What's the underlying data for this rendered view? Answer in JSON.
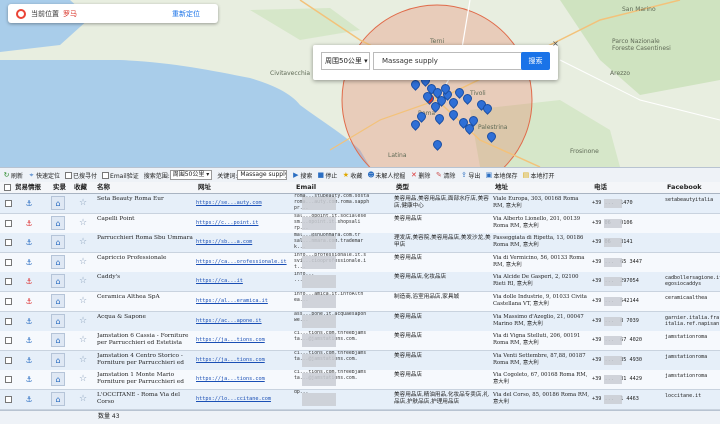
{
  "map": {
    "location_label": "当前位置",
    "city": "罗马",
    "relocate": "重新定位",
    "radius_select": "周围50公里",
    "keyword": "Massage supply",
    "search_button": "搜索",
    "close": "×",
    "labels": [
      "San Marino",
      "Parco Nazionale",
      "Foreste Casentinesi",
      "Arezzo",
      "Terni",
      "Tivoli",
      "Palestrina",
      "Latina",
      "Roma",
      "Civitavecchia",
      "Frosinone"
    ]
  },
  "toolbar": {
    "refresh": "刷新",
    "quick_locate": "快速定位",
    "visited_filter": "已搜寻付",
    "email_verify": "Email验证",
    "search_range_label": "搜索范围:",
    "search_range_value": "周围50公里",
    "keyword_label": "关键词:",
    "keyword_value": "Massage supply",
    "search": "搜索",
    "stop": "停止",
    "favorites": "收藏",
    "unhandled": "未解人挖掘",
    "delete": "删除",
    "clear": "清除",
    "export": "导出",
    "save_local": "本地保存",
    "open_local": "本地打开"
  },
  "columns": [
    "贸易情报",
    "实景",
    "收藏",
    "名称",
    "网址",
    "Email",
    "类型",
    "地址",
    "电话",
    "Facebook"
  ],
  "rows": [
    {
      "name": "Seta Beauty Roma Eur",
      "url": "https://se...auty.com",
      "email": "roma...stubeauty.com.sosta\nroma...auty.com.roma.sapph\npr...",
      "type": "美容用品,美容用品店,面部水疗店,美容店,健康中心",
      "addr": "Viale Europa, 303, 00168 Roma RM, 意大利",
      "phone": "+39 ...  1470",
      "fb": "setabeautyitalia",
      "anchor_red": false
    },
    {
      "name": "Capelli Point",
      "url": "https://c...point.it",
      "email": "sal...opoint.it.socialese\nsm...opoint.it.shopsali\nrp...",
      "type": "美容用品店",
      "addr": "Via Alberto Lionello, 201, 00139 Roma RM, 意大利",
      "phone": "+39 06   0106",
      "fb": "",
      "anchor_red": true
    },
    {
      "name": "Parrucchieri Roma Sbu Ummara",
      "url": "https://sb...a.com",
      "email": "mal...@shuonmara.com.tr\nsal...nmara.com.trademar\nk...",
      "type": "理发店,美容院,美容用品店,美发沙龙,美甲店",
      "addr": "Passeggiata di Ripetta, 13, 00186 Roma RM, 意大利",
      "phone": "+39 06   3141",
      "fb": "",
      "anchor_red": false
    },
    {
      "name": "Capriccio Professionale",
      "url": "https://ca...orofessionale.it",
      "email": "info...professionale.it.s\nsvi...ciooprofessionale.i\nt...",
      "type": "美容用品店",
      "addr": "Via di Vermicino, 56, 00133 Roma RM, 意大利",
      "phone": "+39 ...  65 3447",
      "fb": "",
      "anchor_red": false
    },
    {
      "name": "Caddy's",
      "url": "https://ca...it",
      "email": "info...\n...",
      "type": "美容用品店,化妆品店",
      "addr": "Via Alcide De Gasperi, 2, 02100 Rieti RI, 意大利",
      "phone": "+39 ...  297054",
      "fb": "cadbollersagione.it\negosiocaddys",
      "anchor_red": true
    },
    {
      "name": "Ceramica Althea SpA",
      "url": "https://al...eramica.it",
      "email": "info...amica.it.infoAlth\nea...",
      "type": "制造商,浴室用品店,家具城",
      "addr": "Via dolle Industrie, 9, 01033 Civita Castellana VT, 意大利",
      "phone": "+39 ...  542144",
      "fb": "ceramicaalthea",
      "anchor_red": true
    },
    {
      "name": "Acqua & Sapone",
      "url": "https://ac...apone.it",
      "email": "ass...pone.it.acquaesapon\nwe...",
      "type": "美容用品店",
      "addr": "Via Massimo d'Azeglio, 21, 00047 Marino RM, 意大利",
      "phone": "+39 ...  8 7039",
      "fb": "garnier.italia.fra\nitalia.ref.napisan",
      "anchor_red": false
    },
    {
      "name": "Jamstation 6 Cassia - Forniture per Parrucchieri ed Estetista",
      "url": "https://ja...tions.com",
      "email": "ci...tions.com.threeBjams\nta...@jamstations.com.",
      "type": "美容用品店",
      "addr": "Via di Vigna Stelluti, 206, 00191 Roma RM, 意大利",
      "phone": "+39 ...  67 4020",
      "fb": "jamstationroma",
      "anchor_red": false
    },
    {
      "name": "Jamstation 4 Centro Storico - Forniture per Parrucchieri ed",
      "url": "https://ja...tions.com",
      "email": "ci...tions.com.threeBjams\nta...@jamstations.com.",
      "type": "美容用品店",
      "addr": "Via Venti Settembre, 87,88, 00187 Roma RM, 意大利",
      "phone": "+39 ...  35 4930",
      "fb": "jamstationroma",
      "anchor_red": false
    },
    {
      "name": "Jamstation 1 Monte Mario Forniture per Parrucchieri ed",
      "url": "https://ja...tions.com",
      "email": "ci...tions.com.threeBjams\nta...@jamstations.com.",
      "type": "美容用品店",
      "addr": "Via Cogoleto, 67, 00168 Roma RM, 意大利",
      "phone": "+39 ...  31 4429",
      "fb": "jamstationroma",
      "anchor_red": false
    },
    {
      "name": "L'OCCITANE - Roma Via del Corso",
      "url": "https://lo...ccitane.com",
      "email": "dp...",
      "type": "美容用品店,精油用品,化妆品专卖店,礼品店,护肤品店,护理用品店",
      "addr": "Via del Corso, 85, 00186 Roma RM, 意大利",
      "phone": "+39 ...  1 4463",
      "fb": "loccitane.it",
      "anchor_red": false
    }
  ],
  "status": {
    "count_label": "数量 43"
  }
}
